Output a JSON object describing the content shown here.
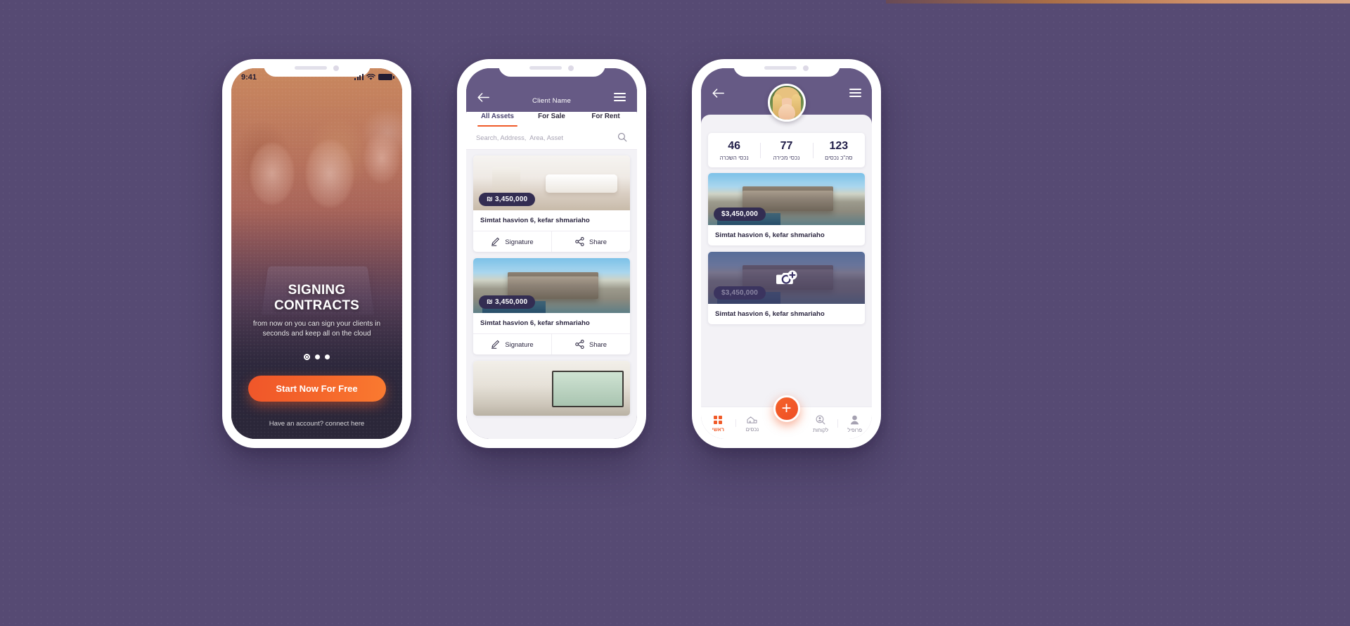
{
  "canvas": {
    "background_color": "#564a73",
    "accent_orange": "#f05a28",
    "brand_purple": "#665a85",
    "badge_navy": "#332d52"
  },
  "phone1": {
    "status_bar": {
      "time": "9:41",
      "signal_icon": "signal-bars-icon",
      "wifi_icon": "wifi-icon",
      "battery_icon": "battery-icon"
    },
    "title": "SIGNING CONTRACTS",
    "subtitle": "from now on you can sign your clients in seconds and keep all on the cloud",
    "pager": {
      "count": 3,
      "active_index": 0
    },
    "cta_label": "Start Now For Free",
    "login_link": "Have an account? connect here"
  },
  "phone2": {
    "header": {
      "back_icon": "back-arrow-icon",
      "title": "Client Name",
      "menu_icon": "hamburger-menu-icon"
    },
    "tabs": [
      {
        "label": "All Assets",
        "active": true
      },
      {
        "label": "For Sale",
        "active": false
      },
      {
        "label": "For Rent",
        "active": false
      }
    ],
    "search": {
      "placeholder": "Search, Address,  Area, Asset",
      "value": "",
      "icon": "search-icon"
    },
    "actions": {
      "signature_label": "Signature",
      "signature_icon": "pen-signature-icon",
      "share_label": "Share",
      "share_icon": "share-icon"
    },
    "cards": [
      {
        "price": "₪ 3,450,000",
        "address": "Simtat hasvion 6, kefar shmariaho",
        "photo": "interior-living-room"
      },
      {
        "price": "₪ 3,450,000",
        "address": "Simtat hasvion 6, kefar shmariaho",
        "photo": "modern-villa-pool"
      },
      {
        "price": "",
        "address": "",
        "photo": "modern-interior-partial"
      }
    ]
  },
  "phone3": {
    "header": {
      "back_icon": "back-arrow-icon",
      "menu_icon": "hamburger-menu-icon",
      "avatar_icon": "user-avatar-photo"
    },
    "stats": [
      {
        "value": "46",
        "label": "נכסי השכרה"
      },
      {
        "value": "77",
        "label": "נכסי מכירה"
      },
      {
        "value": "123",
        "label": "סה\"כ נכסים"
      }
    ],
    "cards": [
      {
        "price": "$3,450,000",
        "address": "Simtat hasvion 6, kefar shmariaho",
        "photo": "modern-villa-pool",
        "overlay_icon": ""
      },
      {
        "price": "$3,450,000",
        "address": "Simtat hasvion 6, kefar shmariaho",
        "photo": "modern-villa-dimmed",
        "overlay_icon": "camera-plus-icon"
      }
    ],
    "fab_label": "+",
    "bottom_nav": [
      {
        "label": "ראשי",
        "icon": "grid-home-icon",
        "active": true
      },
      {
        "label": "נכסים",
        "icon": "house-icon",
        "active": false
      },
      {
        "label": "לקוחות",
        "icon": "client-search-icon",
        "active": false
      },
      {
        "label": "פרופיל",
        "icon": "profile-person-icon",
        "active": false
      }
    ]
  }
}
